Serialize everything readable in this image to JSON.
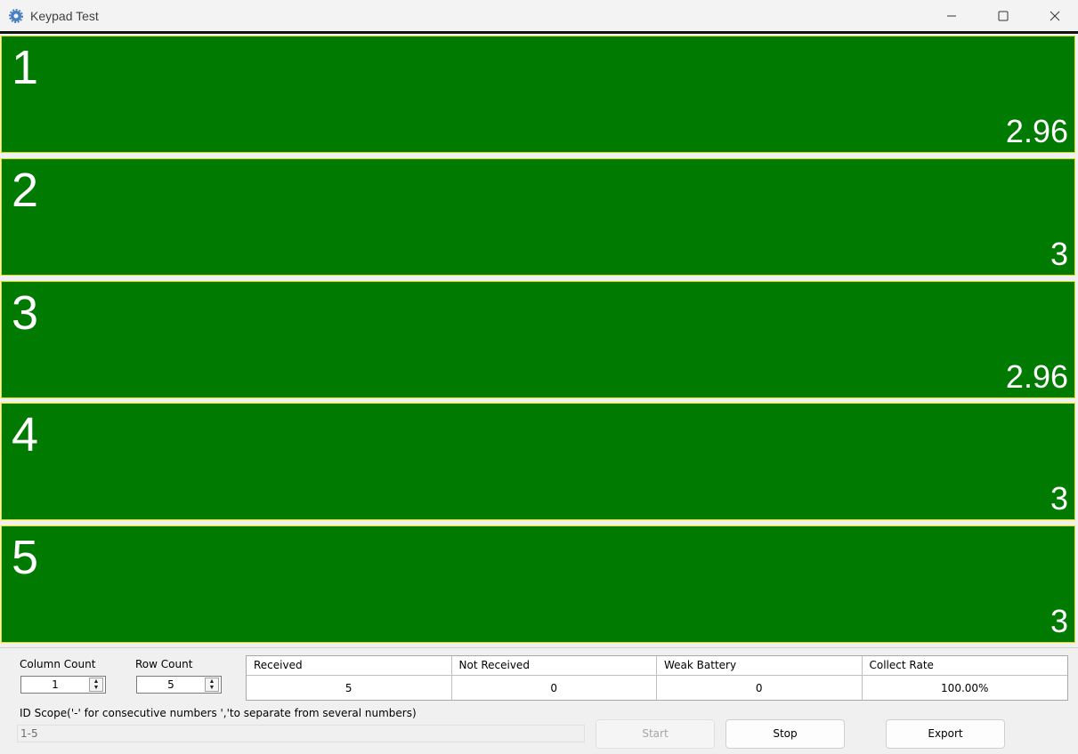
{
  "window": {
    "title": "Keypad Test"
  },
  "tiles": [
    {
      "id": "1",
      "value": "2.96"
    },
    {
      "id": "2",
      "value": "3"
    },
    {
      "id": "3",
      "value": "2.96"
    },
    {
      "id": "4",
      "value": "3"
    },
    {
      "id": "5",
      "value": "3"
    }
  ],
  "colors": {
    "tile_bg": "#007a00",
    "tile_border": "#e8e000"
  },
  "controls": {
    "column_count_label": "Column Count",
    "column_count_value": "1",
    "row_count_label": "Row Count",
    "row_count_value": "5",
    "id_scope_label": "ID Scope('-' for consecutive numbers ','to separate from several numbers)",
    "id_scope_value": "1-5"
  },
  "stats": {
    "headers": [
      "Received",
      "Not Received",
      "Weak Battery",
      "Collect Rate"
    ],
    "values": [
      "5",
      "0",
      "0",
      "100.00%"
    ]
  },
  "buttons": {
    "start": "Start",
    "stop": "Stop",
    "export": "Export"
  }
}
